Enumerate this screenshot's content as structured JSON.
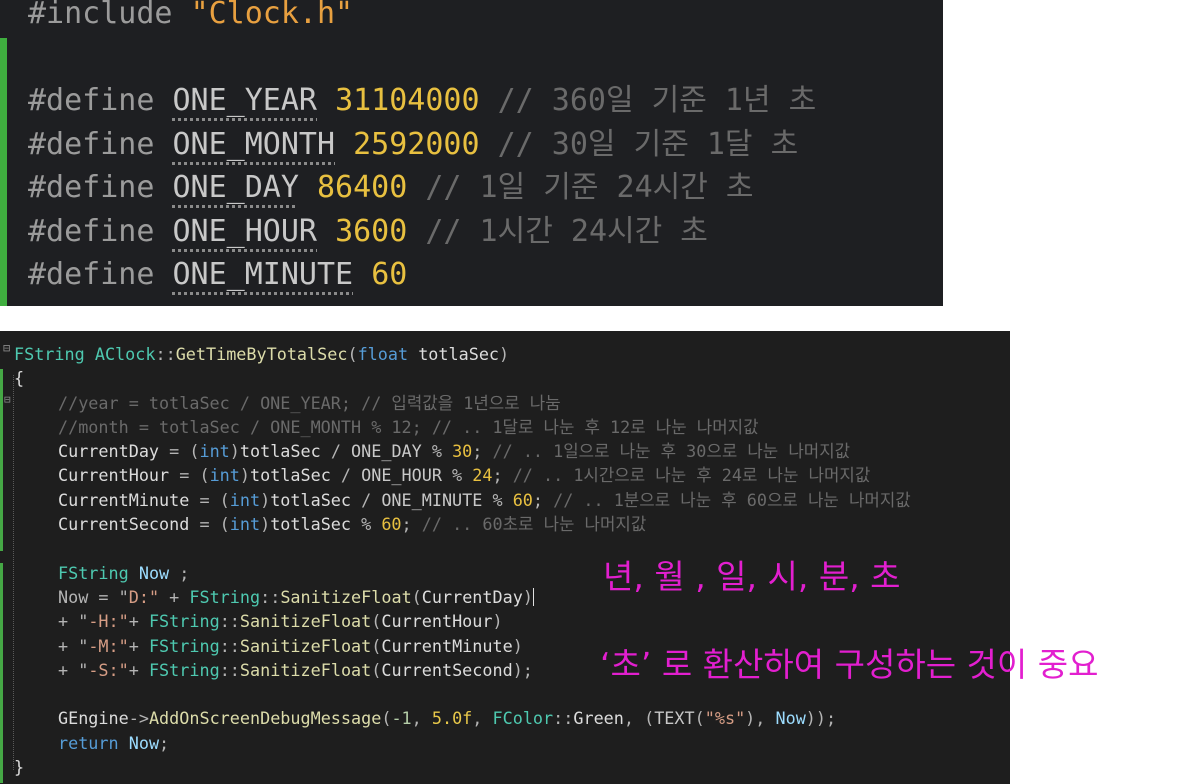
{
  "top_code": {
    "include": {
      "directive": "#include",
      "file": "\"Clock.h\""
    },
    "defines": [
      {
        "directive": "#define",
        "name": "ONE_YEAR",
        "value": "31104000",
        "comment": "// 360일 기준 1년 초"
      },
      {
        "directive": "#define",
        "name": "ONE_MONTH",
        "value": "2592000",
        "comment": "// 30일 기준 1달 초"
      },
      {
        "directive": "#define",
        "name": "ONE_DAY",
        "value": "86400",
        "comment": "// 1일 기준 24시간 초"
      },
      {
        "directive": "#define",
        "name": "ONE_HOUR",
        "value": "3600",
        "comment": "// 1시간 24시간 초"
      },
      {
        "directive": "#define",
        "name": "ONE_MINUTE",
        "value": "60",
        "comment": ""
      }
    ]
  },
  "bottom_code": {
    "signature": {
      "ret_type": "FString",
      "class_name": "AClock",
      "sep": "::",
      "func": "GetTimeByTotalSec",
      "param_type": "float",
      "param": "totlaSec"
    },
    "open_brace": "{",
    "close_brace": "}",
    "comment_year": "//year = totlaSec / ONE_YEAR; // 입력값을 1년으로 나눔",
    "comment_month": "//month = totlaSec / ONE_MONTH % 12; // .. 1달로 나눈 후 12로 나눈 나머지값",
    "assignments": [
      {
        "var": "CurrentDay",
        "cast": "int",
        "arg": "totlaSec",
        "div": "ONE_DAY",
        "mod": "30",
        "comment": "// .. 1일으로 나눈 후 30으로 나눈 나머지값"
      },
      {
        "var": "CurrentHour",
        "cast": "int",
        "arg": "totlaSec",
        "div": "ONE_HOUR",
        "mod": "24",
        "comment": "// .. 1시간으로 나눈 후 24로 나눈 나머지값"
      },
      {
        "var": "CurrentMinute",
        "cast": "int",
        "arg": "totlaSec",
        "div": "ONE_MINUTE",
        "mod": "60",
        "comment": "// .. 1분으로 나눈 후 60으로 나눈 나머지값"
      },
      {
        "var": "CurrentSecond",
        "cast": "int",
        "arg": "totlaSec",
        "div": "",
        "mod": "60",
        "comment": "// .. 60초로 나눈 나머지값"
      }
    ],
    "decl": {
      "type": "FString",
      "name": "Now"
    },
    "now_lines": [
      {
        "lead": "Now = \"",
        "label": "D:",
        "arg": "CurrentDay"
      },
      {
        "lead": "+ \"",
        "label": "-H:",
        "arg": "CurrentHour"
      },
      {
        "lead": "+ \"",
        "label": "-M:",
        "arg": "CurrentMinute"
      },
      {
        "lead": "+ \"",
        "label": "-S:",
        "arg": "CurrentSecond"
      }
    ],
    "fstring_cls": "FString",
    "sanitize_fn": "SanitizeFloat",
    "debug": {
      "obj": "GEngine",
      "arrow": "->",
      "fn": "AddOnScreenDebugMessage",
      "arg1": "-1",
      "arg2": "5.0f",
      "color_cls": "FColor",
      "color": "Green",
      "text_macro": "TEXT",
      "fmt": "%s",
      "var": "Now"
    },
    "ret": {
      "kw": "return",
      "var": "Now"
    }
  },
  "annotations": {
    "units": "년, 월 , 일, 시, 분, 초",
    "note": "‘초’ 로 환산하여 구성하는 것이 중요"
  },
  "colors": {
    "annotation": "#e21fcf",
    "gutter_green": "#3fae3f",
    "keyword": "#569cd6",
    "number": "#e8c040"
  }
}
